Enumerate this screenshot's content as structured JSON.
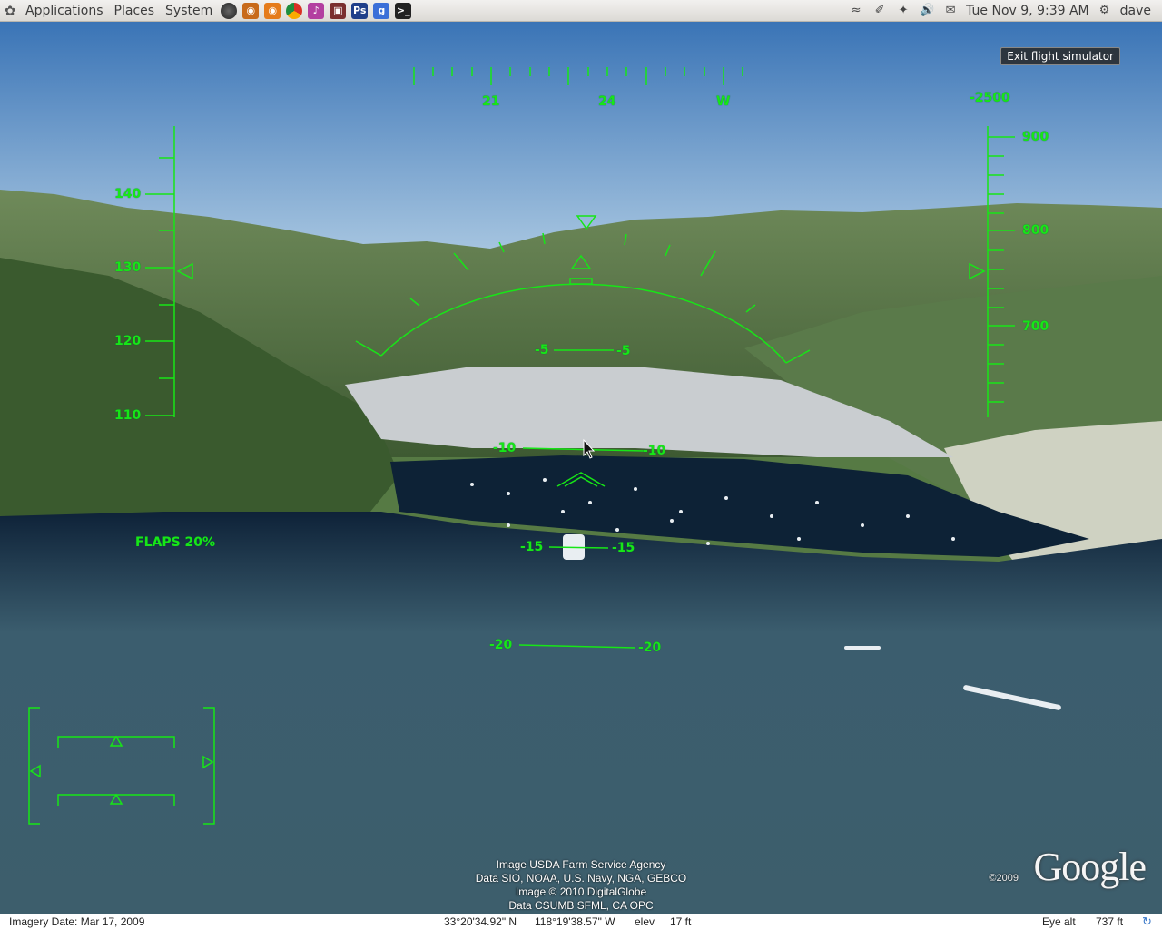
{
  "panel": {
    "menus": [
      "Applications",
      "Places",
      "System"
    ],
    "launchers": [
      "earth-icon",
      "camera-icon",
      "firefox-icon",
      "chrome-icon",
      "music-icon",
      "briefcase-icon",
      "photoshop-icon",
      "google-icon",
      "terminal-icon"
    ],
    "datetime": "Tue Nov 9,  9:39 AM",
    "user": "dave"
  },
  "hud": {
    "exit_button": "Exit flight simulator",
    "heading_labels": [
      "21",
      "24",
      "W"
    ],
    "vertical_speed": "-2500",
    "speed_labels": [
      "140",
      "130",
      "120",
      "110"
    ],
    "altitude_labels": [
      "900",
      "800",
      "700"
    ],
    "pitch_labels": {
      "minus5": "-5",
      "minus10": "-10",
      "minus15": "-15",
      "minus20": "-20"
    },
    "flaps": "FLAPS 20%"
  },
  "credits": {
    "line1": "Image USDA Farm Service Agency",
    "line2": "Data SIO, NOAA, U.S. Navy, NGA, GEBCO",
    "line3": "Image © 2010 DigitalGlobe",
    "line4": "Data CSUMB SFML, CA OPC",
    "google_copyright": "©2009",
    "google_logo": "Google"
  },
  "status": {
    "imagery_date": "Imagery Date: Mar 17, 2009",
    "lat": "33°20'34.92\" N",
    "lon": "118°19'38.57\" W",
    "elev_label": "elev",
    "elev_value": "17 ft",
    "eye_alt_label": "Eye alt",
    "eye_alt_value": "737 ft"
  }
}
